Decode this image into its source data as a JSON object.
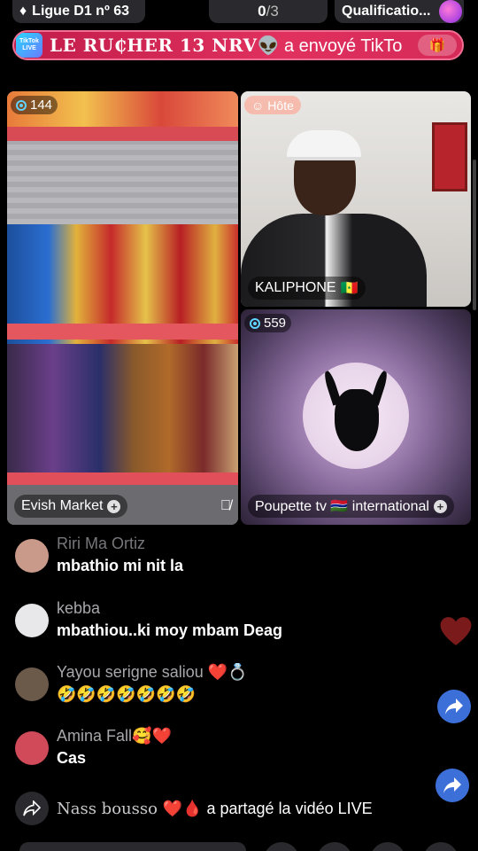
{
  "top": {
    "league": "Ligue D1 nº 63",
    "count_current": "0",
    "count_total": "/3",
    "qualification": "Qualificatio..."
  },
  "banner": {
    "logo_text": "TikTok LIVE",
    "sender": "LE RU₵HER 13 NRV",
    "action": " a envoyé TikTo"
  },
  "tiles": [
    {
      "viewers": "144",
      "name": "Evish Market",
      "muted": true
    },
    {
      "host_label": "Hôte",
      "name": "KALIPHONE"
    },
    {
      "viewers": "559",
      "name": "Poupette tv 🇬🇲 international"
    }
  ],
  "comments": [
    {
      "user": "Riri Ma Ortiz",
      "text": "mbathio mi nit la",
      "avatar_color": "#c99a8a"
    },
    {
      "user": "kebba",
      "text": "mbathiou..ki moy mbam Deag",
      "avatar_color": "#e8e8ea"
    },
    {
      "user": "Yayou serigne saliou ❤️💍",
      "text": "🤣🤣🤣🤣🤣🤣🤣",
      "avatar_color": "#6b5a4a"
    },
    {
      "user": "Amina Fall🥰❤️",
      "text": "Cas",
      "avatar_color": "#d04a5a"
    }
  ],
  "shared": {
    "name": "Nass bousso ❤️🩸",
    "action": " a partagé la vidéo LIVE"
  },
  "colors": {
    "banner": "#d62a58",
    "share": "#3d6fd8",
    "heart": "#7a1a1a"
  }
}
